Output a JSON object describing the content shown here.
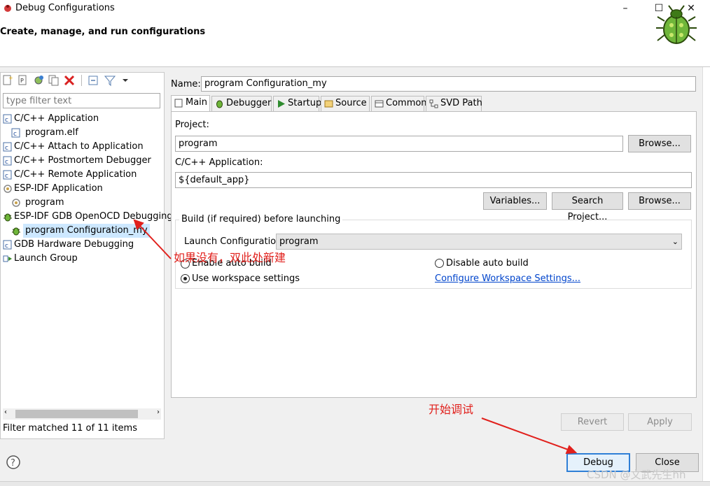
{
  "window": {
    "title": "Debug Configurations",
    "minimize": "–",
    "maximize": "☐",
    "close": "✕"
  },
  "banner": {
    "title": "Create, manage, and run configurations"
  },
  "left": {
    "filter_placeholder": "type filter text",
    "tree": [
      {
        "label": "C/C++ Application",
        "icon": "c-app-icon"
      },
      {
        "label": "program.elf",
        "icon": "c-app-icon"
      },
      {
        "label": "C/C++ Attach to Application",
        "icon": "c-app-icon"
      },
      {
        "label": "C/C++ Postmortem Debugger",
        "icon": "c-app-icon"
      },
      {
        "label": "C/C++ Remote Application",
        "icon": "c-app-icon"
      },
      {
        "label": "ESP-IDF Application",
        "icon": "gear-icon"
      },
      {
        "label": "program",
        "icon": "gear-icon"
      },
      {
        "label": "ESP-IDF GDB OpenOCD Debugging",
        "icon": "bug-icon"
      },
      {
        "label": "program Configuration_my",
        "icon": "bug-icon"
      },
      {
        "label": "GDB Hardware Debugging",
        "icon": "c-app-icon"
      },
      {
        "label": "Launch Group",
        "icon": "launch-group-icon"
      }
    ],
    "status": "Filter matched 11 of 11 items"
  },
  "main": {
    "name_label": "Name:",
    "name_value": "program Configuration_my",
    "tabs": [
      {
        "label": "Main"
      },
      {
        "label": "Debugger"
      },
      {
        "label": "Startup"
      },
      {
        "label": "Source"
      },
      {
        "label": "Common"
      },
      {
        "label": "SVD Path"
      }
    ],
    "project_label": "Project:",
    "project_value": "program",
    "browse_label": "Browse...",
    "app_label": "C/C++ Application:",
    "app_value": "${default_app}",
    "variables_label": "Variables...",
    "search_project_label": "Search Project...",
    "build_group_title": "Build (if required) before launching",
    "launch_config_label": "Launch Configuration:",
    "launch_config_value": "program",
    "enable_auto_build": "Enable auto build",
    "disable_auto_build": "Disable auto build",
    "use_workspace_settings": "Use workspace settings",
    "configure_workspace_link": "Configure Workspace Settings...",
    "revert_label": "Revert",
    "apply_label": "Apply"
  },
  "footer": {
    "debug_label": "Debug",
    "close_label": "Close",
    "help_icon": "?"
  },
  "annotations": {
    "note_new": "如果没有，双此处新建",
    "note_start": "开始调试",
    "watermark": "CSDN @文武先生hh"
  },
  "colors": {
    "annotation": "#e1201c",
    "selection": "#cde8ff",
    "link": "#0044cc"
  }
}
